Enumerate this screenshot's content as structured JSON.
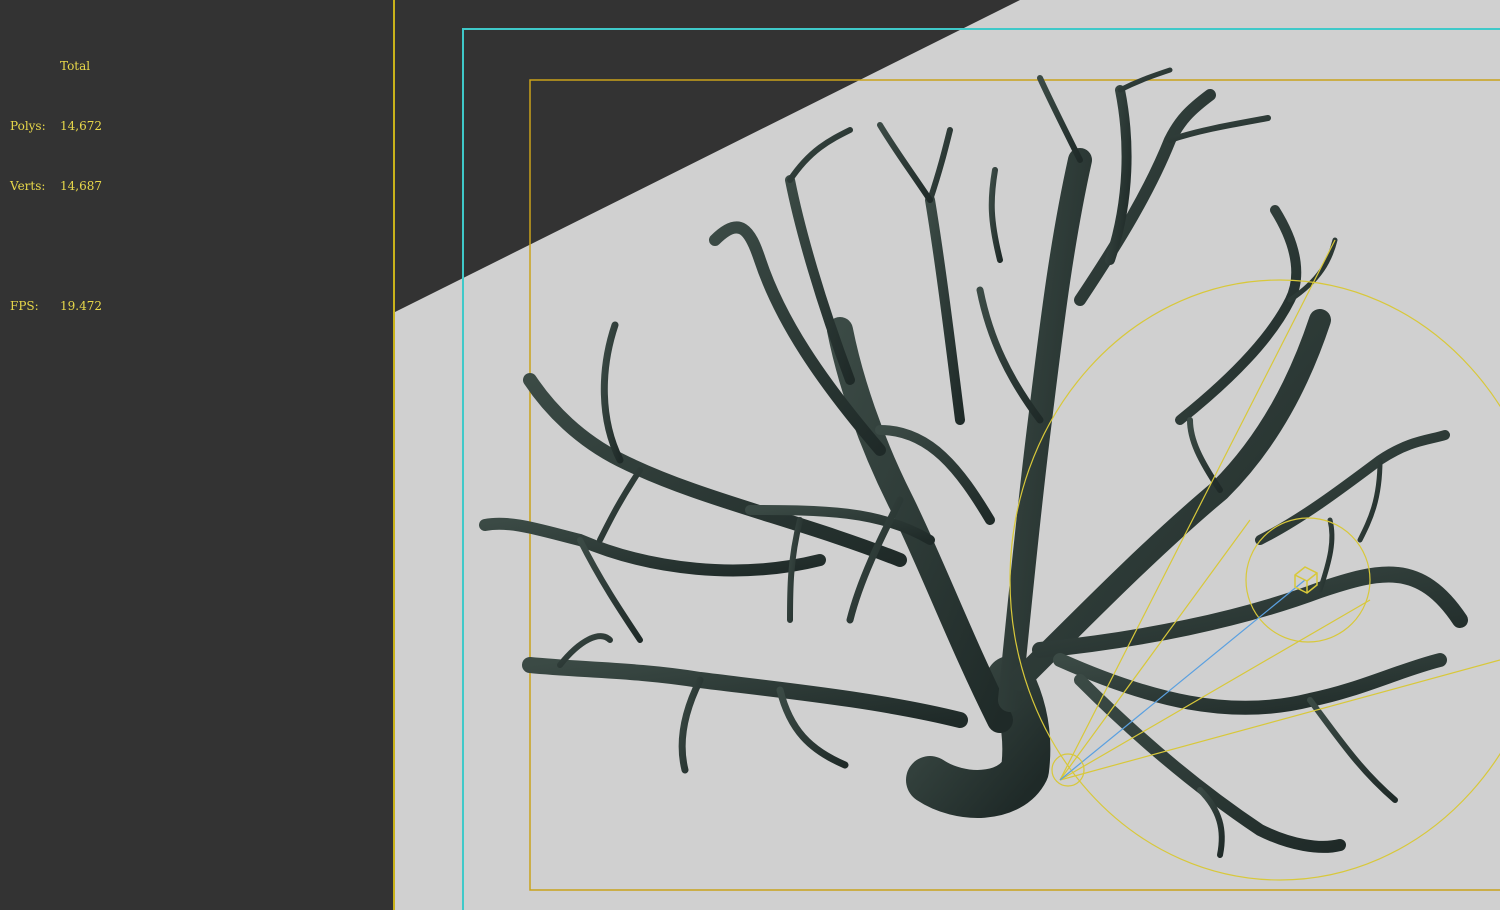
{
  "stats": {
    "header": "Total",
    "polys_label": "Polys:",
    "polys_value": "14,672",
    "verts_label": "Verts:",
    "verts_value": "14,687",
    "fps_label": "FPS:",
    "fps_value": "19.472"
  },
  "colors": {
    "background": "#333333",
    "floor": "#d0d0d0",
    "stat_text": "#e8d84a",
    "safe_frame_outer": "#3fc9c9",
    "safe_frame_inner": "#c9a21a",
    "light_gizmo": "#d8c83a",
    "branch_dark": "#1f2a28",
    "branch_mid": "#3b4a45"
  },
  "scene": {
    "object": "branching-tree-mesh",
    "light": "spot-light-gizmo"
  }
}
